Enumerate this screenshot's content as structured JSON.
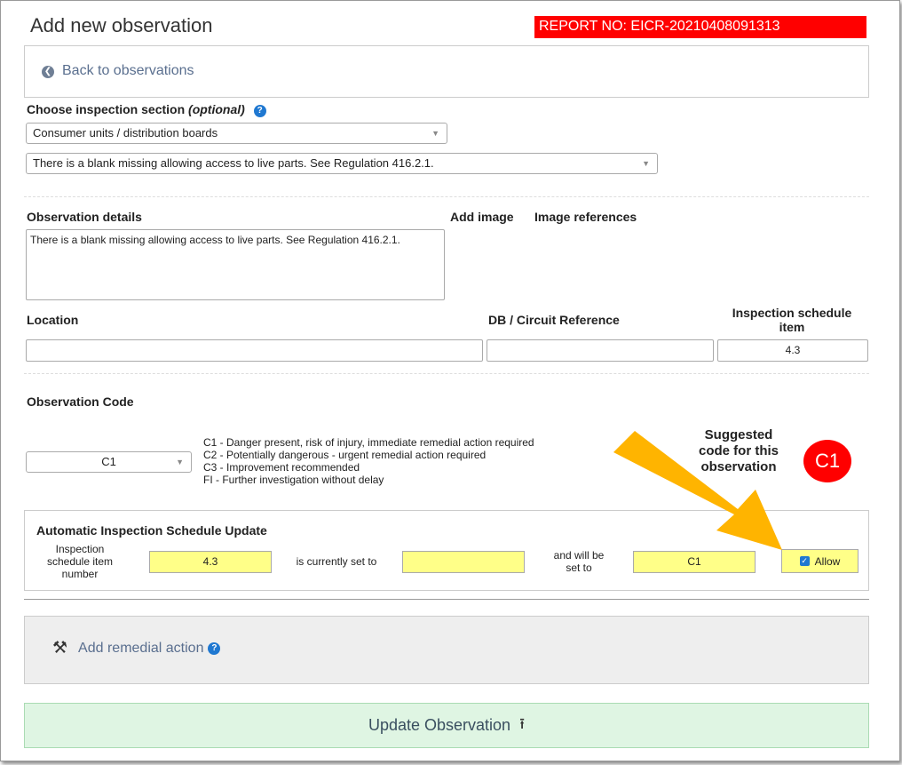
{
  "header": {
    "title": "Add new observation",
    "report_no": "REPORT NO: EICR-20210408091313"
  },
  "back": {
    "label": "Back to observations"
  },
  "section": {
    "label": "Choose inspection section",
    "optional": "(optional)",
    "help": "?",
    "selected_section": "Consumer units / distribution boards",
    "selected_observation": "There is a blank missing allowing access to live parts. See Regulation 416.2.1."
  },
  "details": {
    "label": "Observation details",
    "value": "There is a blank missing allowing access to live parts. See Regulation 416.2.1.",
    "add_image": "Add image",
    "image_refs": "Image references"
  },
  "location": {
    "label": "Location",
    "value": "",
    "db_label": "DB / Circuit Reference",
    "db_value": "",
    "schedule_label": "Inspection schedule item",
    "schedule_value": "4.3"
  },
  "code": {
    "label": "Observation Code",
    "selected": "C1",
    "descriptions": [
      "C1 - Danger present, risk of injury, immediate remedial action required",
      "C2 - Potentially dangerous - urgent remedial action required",
      "C3 - Improvement recommended",
      "FI - Further investigation without delay"
    ],
    "suggested_text": "Suggested code for this observation",
    "suggested_code": "C1"
  },
  "auto_update": {
    "title": "Automatic Inspection Schedule Update",
    "item_label": "Inspection schedule item number",
    "item_value": "4.3",
    "current_label": "is currently set to",
    "current_value": "",
    "will_label": "and will be set to",
    "will_value": "C1",
    "allow_label": "Allow",
    "allow_checked": true
  },
  "remedial": {
    "label": "Add remedial action",
    "help": "?"
  },
  "update": {
    "label": "Update Observation"
  },
  "colors": {
    "accent": "#ffb400",
    "report_bg": "#ff0000",
    "yellow_field": "#ffff88",
    "update_bg": "#dff5e3"
  }
}
